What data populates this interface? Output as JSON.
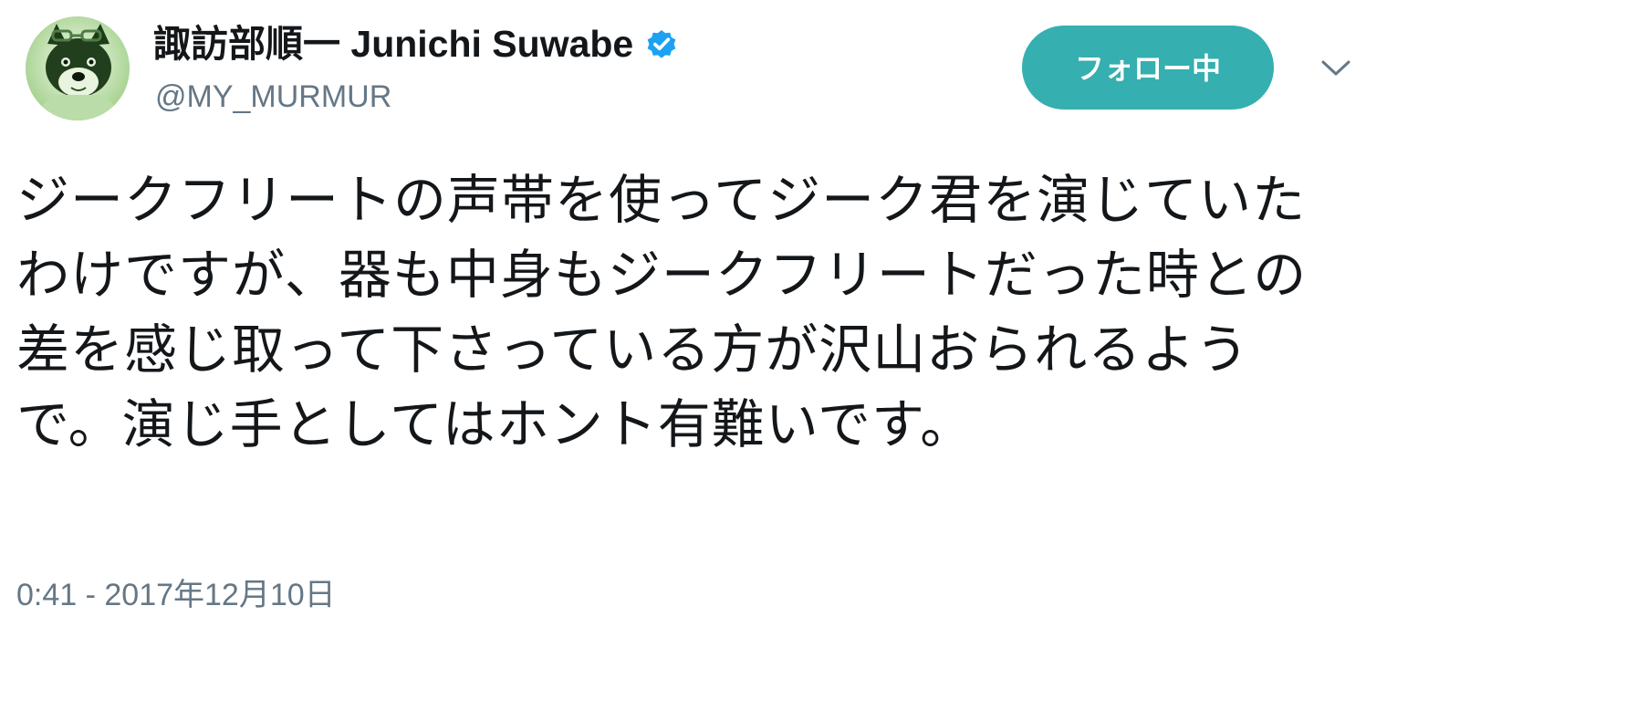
{
  "user": {
    "display_name": "諏訪部順一 Junichi Suwabe",
    "handle": "@MY_MURMUR",
    "verified": true
  },
  "follow_button": {
    "label": "フォロー中"
  },
  "tweet": {
    "text": "ジークフリートの声帯を使ってジーク君を演じていたわけですが、器も中身もジークフリートだった時との差を感じ取って下さっている方が沢山おられるようで。演じ手としてはホント有難いです。",
    "timestamp": "0:41 - 2017年12月10日"
  },
  "icons": {
    "verified": "verified-badge-icon",
    "caret": "chevron-down-icon",
    "avatar": "dog-avatar"
  },
  "colors": {
    "follow_button_bg": "#35afaf",
    "verified_badge": "#1da1f2",
    "secondary_text": "#657786",
    "primary_text": "#14171a"
  }
}
